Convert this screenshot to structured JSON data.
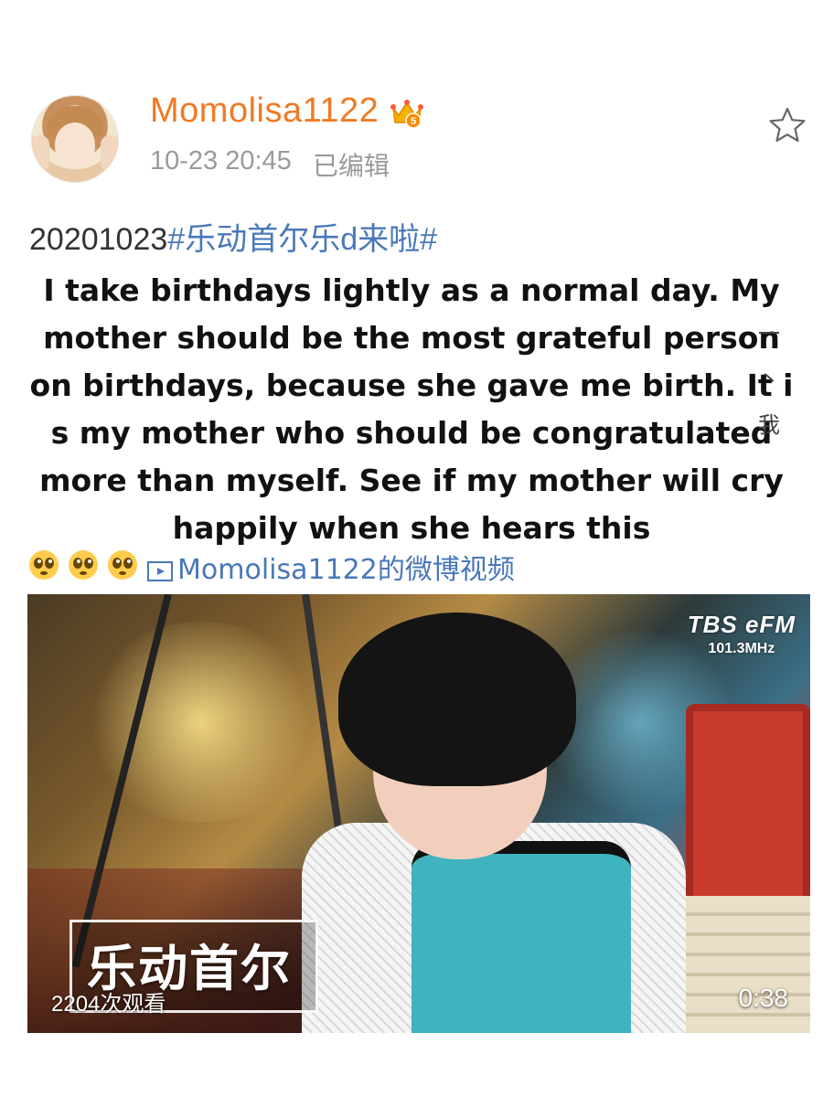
{
  "post": {
    "username": "Momolisa1122",
    "timestamp": "10-23 20:45",
    "edited_label": "已编辑",
    "date_prefix": "20201023",
    "hashtag": "#乐动首尔乐d来啦#",
    "caption_lines": [
      "I take birthdays lightly as a normal day. My",
      "mother should be the most grateful person",
      "on birthdays, because she gave me birth. It i",
      "s my mother who should be congratulated",
      "more than myself. See if my mother will cry",
      "happily when she hears this"
    ],
    "side_chars": [
      "一",
      "丶",
      "我"
    ],
    "emoji_count": 3,
    "video_link_text": "Momolisa1122的微博视频"
  },
  "video": {
    "logo_brand": "TBS eFM",
    "logo_freq": "101.3MHz",
    "overlay_title": "乐动首尔",
    "view_count": "2204次观看",
    "duration": "0:38"
  },
  "colors": {
    "username": "#f07a23",
    "hashtag": "#4a78b8",
    "meta": "#9a9a9a"
  },
  "icons": {
    "badge": "crown-badge-icon",
    "favorite": "star-icon",
    "link": "video-link-icon",
    "emoji": "pleading-face-emoji"
  }
}
